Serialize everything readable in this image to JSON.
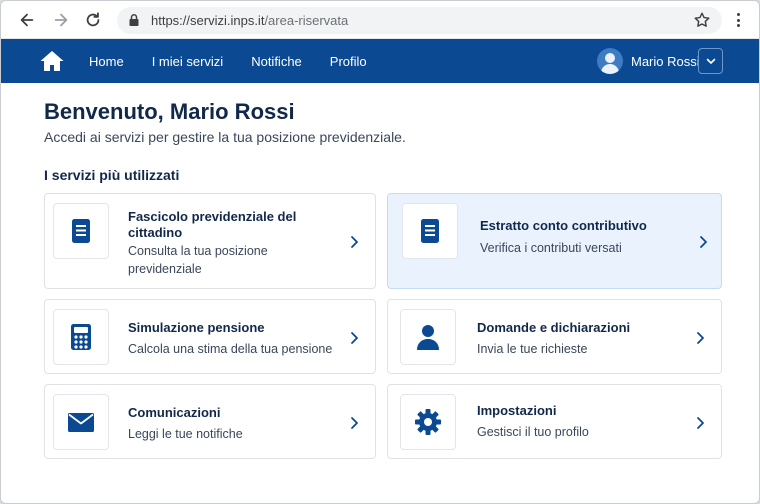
{
  "browser": {
    "url_main": "https://servizi.inps.it",
    "url_path": "/area-riservata"
  },
  "header": {
    "nav": [
      "Home",
      "I miei servizi",
      "Notifiche",
      "Profilo"
    ],
    "user_name": "Mario Rossi"
  },
  "page": {
    "title": "Benvenuto, Mario Rossi",
    "subtitle": "Accedi ai servizi per gestire la tua posizione previdenziale.",
    "section_title": "I servizi più utilizzati"
  },
  "cards": [
    {
      "title": "Fascicolo previdenziale del cittadino",
      "desc": "Consulta la tua posizione previdenziale",
      "icon": "document-icon",
      "active": false
    },
    {
      "title": "Estratto conto contributivo",
      "desc": "Verifica i contributi versati",
      "icon": "document-icon",
      "active": true
    },
    {
      "title": "Simulazione pensione",
      "desc": "Calcola una stima della tua pensione",
      "icon": "calculator-icon",
      "active": false
    },
    {
      "title": "Domande e dichiarazioni",
      "desc": "Invia le tue richieste",
      "icon": "person-icon",
      "active": false
    },
    {
      "title": "Comunicazioni",
      "desc": "Leggi le tue notifiche",
      "icon": "envelope-icon",
      "active": false
    },
    {
      "title": "Impostazioni",
      "desc": "Gestisci il tuo profilo",
      "icon": "gear-icon",
      "active": false
    }
  ],
  "colors": {
    "brand": "#0b4a93",
    "active_card": "#eaf3fd",
    "title": "#12284b"
  }
}
